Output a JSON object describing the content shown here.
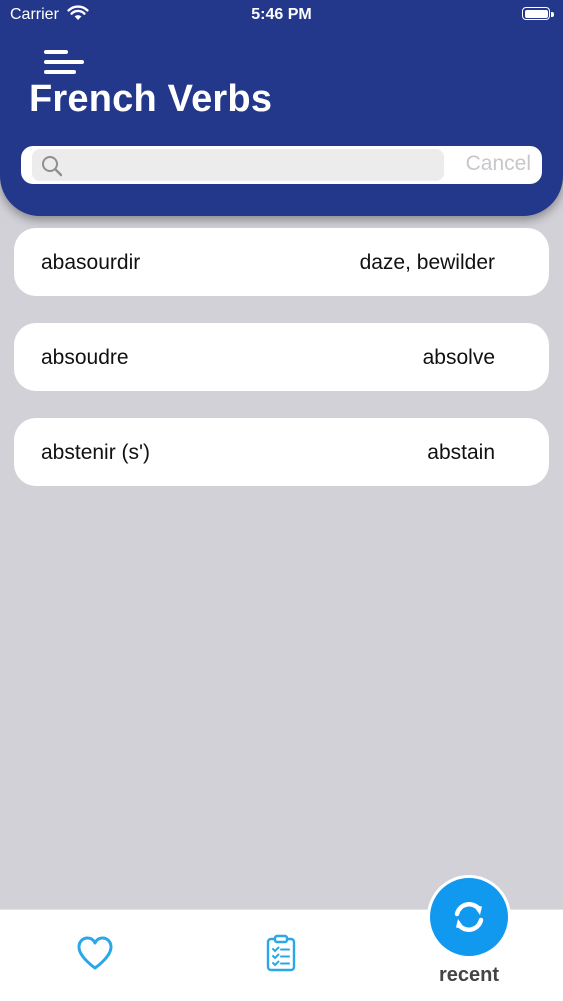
{
  "status_bar": {
    "carrier": "Carrier",
    "time": "5:46 PM",
    "icons": [
      "wifi-icon",
      "battery-icon"
    ]
  },
  "header": {
    "menu_icon": "hamburger-menu-icon",
    "title": "French Verbs",
    "background_color": "#23388a"
  },
  "search": {
    "placeholder": "",
    "value": "",
    "icon": "search-icon",
    "cancel_label": "Cancel"
  },
  "verbs": [
    {
      "french": "abasourdir",
      "english": "daze, bewilder"
    },
    {
      "french": "absoudre",
      "english": "absolve"
    },
    {
      "french": "abstenir (s')",
      "english": "abstain"
    }
  ],
  "tab_bar": {
    "tabs": [
      {
        "icon": "heart-icon"
      },
      {
        "icon": "clipboard-checklist-icon"
      },
      {
        "icon": "refresh-icon",
        "label": "recent"
      }
    ],
    "accent_color": "#1199f0"
  }
}
